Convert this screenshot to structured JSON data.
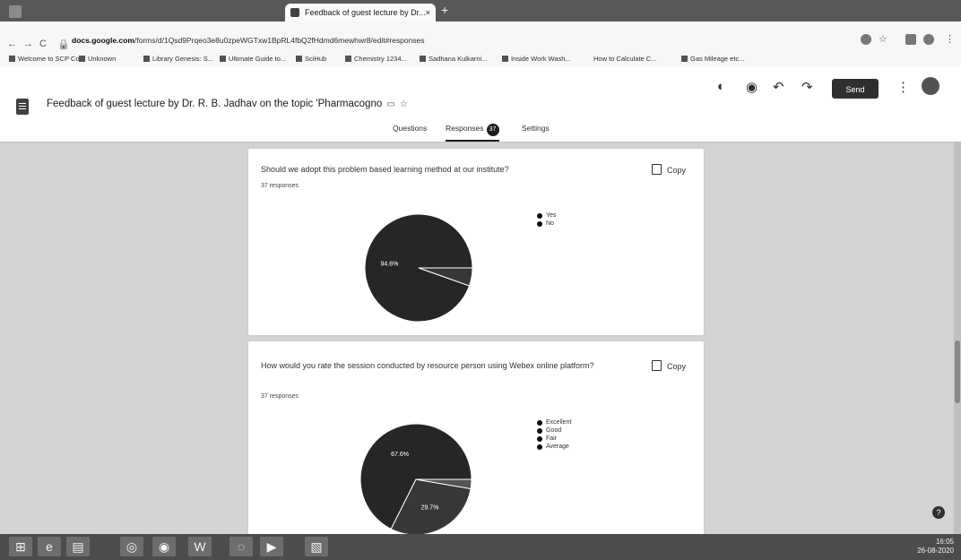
{
  "browser": {
    "active_tab_title": "Feedback of guest lecture by Dr...",
    "url_prefix": "docs.google.com",
    "url_rest": "/forms/d/1Qsd9Prqeo3e8u0zpeWGTxw1BpRL4fbQ2fHdmd6mewhwr8/edit#responses",
    "bookmarks": [
      "Welcome to SCP Co...",
      "Unknown",
      "Library Genesis: S...",
      "Ultimate Guide to...",
      "SciHub",
      "Chemistry 1234...",
      "Sadhana Kulkarni...",
      "Inside Work Wash...",
      "How to Calculate C...",
      "Gas Mileage etc..."
    ]
  },
  "form": {
    "title": "Feedback of guest lecture  by Dr. R. B. Jadhav on the topic 'Pharmacogno",
    "send_label": "Send",
    "tabs": {
      "questions": "Questions",
      "responses": "Responses",
      "responses_count": "37",
      "settings": "Settings"
    }
  },
  "questions": [
    {
      "text": "Should we adopt this problem based learning method at our institute?",
      "responses": "37 responses",
      "copy_label": "Copy",
      "legend": [
        "Yes",
        "No"
      ],
      "pie_label": "94.6%"
    },
    {
      "text": "How would you rate the session conducted by resource person using Webex online platform?",
      "responses": "37 responses",
      "copy_label": "Copy",
      "legend": [
        "Excellent",
        "Good",
        "Fair",
        "Average"
      ],
      "pie_labels": [
        "67.6%",
        "29.7%"
      ]
    }
  ],
  "chart_data": [
    {
      "type": "pie",
      "title": "Should we adopt this problem based learning method at our institute?",
      "categories": [
        "Yes",
        "No"
      ],
      "values": [
        94.6,
        5.4
      ],
      "legend_position": "right"
    },
    {
      "type": "pie",
      "title": "How would you rate the session conducted by resource person using Webex online platform?",
      "categories": [
        "Excellent",
        "Good",
        "Fair",
        "Average"
      ],
      "values": [
        67.6,
        29.7,
        2.7,
        0
      ],
      "legend_position": "right"
    }
  ],
  "taskbar": {
    "time": "16:05",
    "date": "26-08-2020"
  }
}
